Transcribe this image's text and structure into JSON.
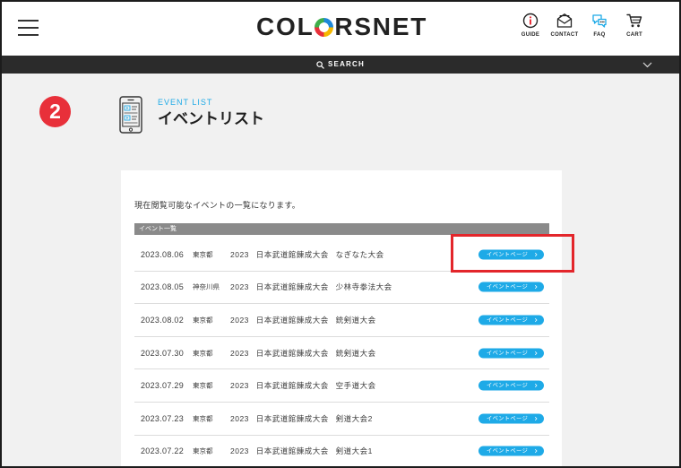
{
  "header": {
    "logo": {
      "part1": "COL",
      "part2": "RSNET"
    },
    "menu_icon": "hamburger-icon",
    "nav": [
      {
        "label": "GUIDE",
        "icon": "info-icon"
      },
      {
        "label": "CONTACT",
        "icon": "envelope-icon"
      },
      {
        "label": "FAQ",
        "icon": "chat-bubbles-icon"
      },
      {
        "label": "CART",
        "icon": "cart-icon"
      }
    ]
  },
  "search_bar": {
    "label": "SEARCH",
    "icon": "search-icon",
    "toggle_icon": "chevron-down-icon"
  },
  "step_badge": "2",
  "page_heading": {
    "icon": "smartphone-list-icon",
    "eyebrow": "EVENT LIST",
    "title": "イベントリスト"
  },
  "card": {
    "intro": "現在閲覧可能なイベントの一覧になります。",
    "list_header": "イベント一覧",
    "button_label": "イベントページ",
    "button_icon": "chevron-right-icon",
    "rows": [
      {
        "date": "2023.08.06",
        "prefecture": "東京都",
        "title": "2023 日本武道館錬成大会 なぎなた大会"
      },
      {
        "date": "2023.08.05",
        "prefecture": "神奈川県",
        "title": "2023 日本武道館錬成大会 少林寺拳法大会"
      },
      {
        "date": "2023.08.02",
        "prefecture": "東京都",
        "title": "2023 日本武道館錬成大会 銃剣道大会"
      },
      {
        "date": "2023.07.30",
        "prefecture": "東京都",
        "title": "2023 日本武道館錬成大会 銃剣道大会"
      },
      {
        "date": "2023.07.29",
        "prefecture": "東京都",
        "title": "2023 日本武道館錬成大会 空手道大会"
      },
      {
        "date": "2023.07.23",
        "prefecture": "東京都",
        "title": "2023 日本武道館錬成大会 剣道大会2"
      },
      {
        "date": "2023.07.22",
        "prefecture": "東京都",
        "title": "2023 日本武道館錬成大会 剣道大会1"
      }
    ]
  },
  "colors": {
    "accent": "#1eaae7",
    "badge": "#e8303a",
    "highlight": "#e3262b",
    "searchbar": "#2b2b2b",
    "listhead": "#8a8a8a"
  }
}
